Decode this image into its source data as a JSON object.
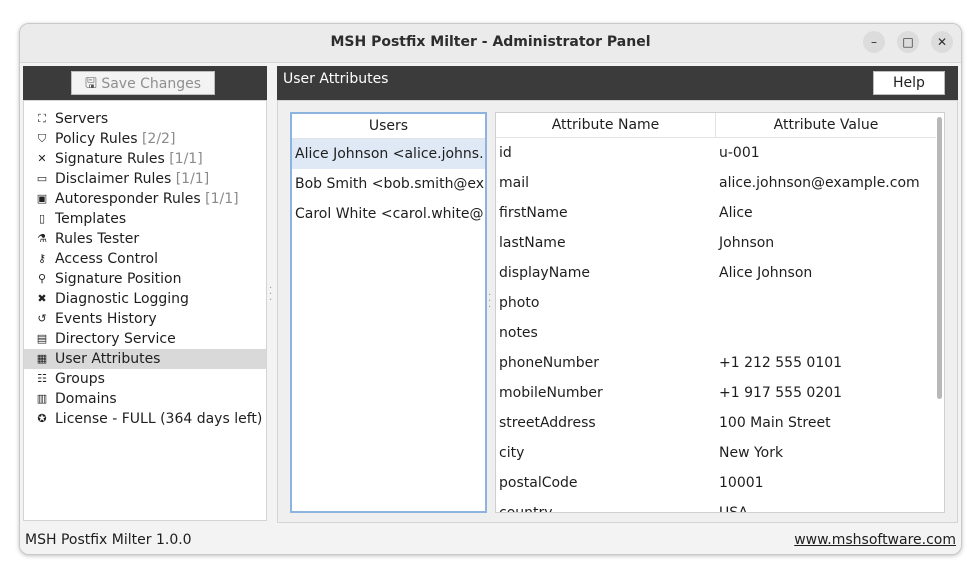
{
  "window": {
    "title": "MSH Postfix Milter - Administrator Panel",
    "minimize_icon": "minimize-icon",
    "maximize_icon": "maximize-icon",
    "close_icon": "close-icon"
  },
  "toolbar": {
    "save_label": "Save Changes",
    "save_icon": "save-icon",
    "help_label": "Help"
  },
  "sidebar": {
    "items": [
      {
        "icon": "servers-icon",
        "glyph": "⛶",
        "label": "Servers",
        "count": ""
      },
      {
        "icon": "policy-icon",
        "glyph": "⛉",
        "label": "Policy Rules",
        "count": "[2/2]"
      },
      {
        "icon": "signature-icon",
        "glyph": "✕",
        "label": "Signature Rules",
        "count": "[1/1]"
      },
      {
        "icon": "disclaimer-icon",
        "glyph": "▭",
        "label": "Disclaimer Rules",
        "count": "[1/1]"
      },
      {
        "icon": "autoresponder-icon",
        "glyph": "▣",
        "label": "Autoresponder Rules",
        "count": "[1/1]"
      },
      {
        "icon": "templates-icon",
        "glyph": "▯",
        "label": "Templates",
        "count": ""
      },
      {
        "icon": "tester-icon",
        "glyph": "⚗",
        "label": "Rules Tester",
        "count": ""
      },
      {
        "icon": "key-icon",
        "glyph": "⚷",
        "label": "Access Control",
        "count": ""
      },
      {
        "icon": "location-pin-icon",
        "glyph": "⚲",
        "label": "Signature Position",
        "count": ""
      },
      {
        "icon": "tools-icon",
        "glyph": "✖",
        "label": "Diagnostic Logging",
        "count": ""
      },
      {
        "icon": "history-icon",
        "glyph": "↺",
        "label": "Events History",
        "count": ""
      },
      {
        "icon": "folder-icon",
        "glyph": "▤",
        "label": "Directory Service",
        "count": ""
      },
      {
        "icon": "id-card-icon",
        "glyph": "▦",
        "label": "User Attributes",
        "count": ""
      },
      {
        "icon": "groups-icon",
        "glyph": "☷",
        "label": "Groups",
        "count": ""
      },
      {
        "icon": "domains-icon",
        "glyph": "▥",
        "label": "Domains",
        "count": ""
      },
      {
        "icon": "license-icon",
        "glyph": "✪",
        "label": "License - FULL (364 days left)",
        "count": ""
      }
    ],
    "selected_index": 12
  },
  "main": {
    "title": "User Attributes",
    "users_header": "Users",
    "users": [
      "Alice Johnson <alice.johns...",
      "Bob Smith <bob.smith@ex...",
      "Carol White <carol.white@..."
    ],
    "selected_user": 0,
    "attributes_header": {
      "name": "Attribute Name",
      "value": "Attribute Value"
    },
    "attributes": [
      {
        "name": "id",
        "value": "u-001"
      },
      {
        "name": "mail",
        "value": "alice.johnson@example.com"
      },
      {
        "name": "firstName",
        "value": "Alice"
      },
      {
        "name": "lastName",
        "value": "Johnson"
      },
      {
        "name": "displayName",
        "value": "Alice Johnson"
      },
      {
        "name": "photo",
        "value": ""
      },
      {
        "name": "notes",
        "value": ""
      },
      {
        "name": "phoneNumber",
        "value": "+1 212 555 0101"
      },
      {
        "name": "mobileNumber",
        "value": "+1 917 555 0201"
      },
      {
        "name": "streetAddress",
        "value": "100 Main Street"
      },
      {
        "name": "city",
        "value": "New York"
      },
      {
        "name": "postalCode",
        "value": "10001"
      },
      {
        "name": "country",
        "value": "USA"
      }
    ]
  },
  "status": {
    "version": "MSH Postfix Milter 1.0.0",
    "website": "www.mshsoftware.com"
  }
}
